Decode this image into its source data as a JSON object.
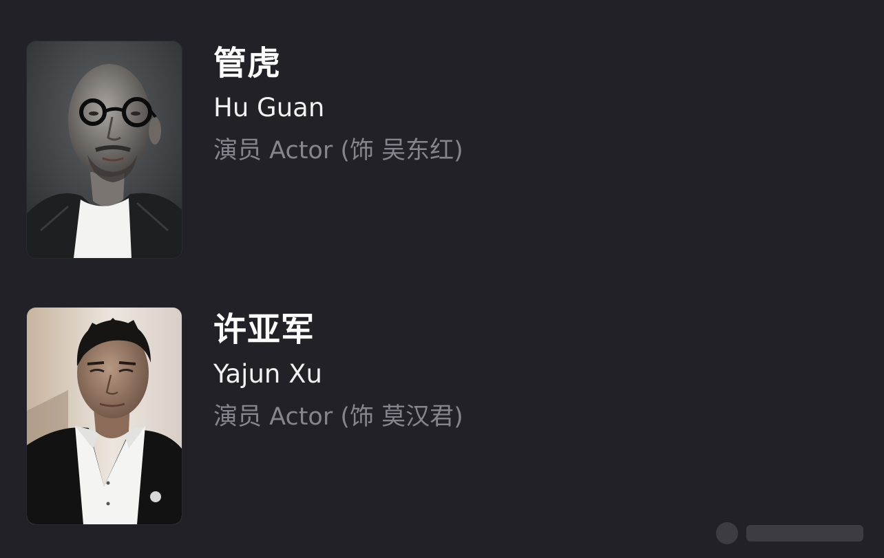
{
  "theme": {
    "background": "#222127",
    "name_color": "#ffffff",
    "subtitle_color": "#86858d"
  },
  "cast": [
    {
      "name_zh": "管虎",
      "name_en": "Hu Guan",
      "role": "演员 Actor (饰 吴东红)",
      "photo": "portrait-photo-bald-man-round-glasses"
    },
    {
      "name_zh": "许亚军",
      "name_en": "Yajun Xu",
      "role": "演员 Actor (饰 莫汉君)",
      "photo": "portrait-photo-man-dark-jacket"
    }
  ]
}
